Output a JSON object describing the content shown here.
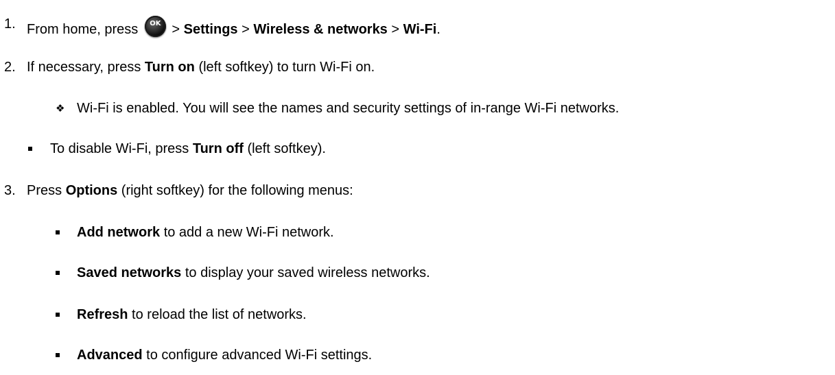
{
  "steps": {
    "step1": {
      "number": "1.",
      "prefix": "From home, press",
      "ok_icon_label": "OK",
      "sep1": ">",
      "settings": "Settings",
      "sep2": ">",
      "wireless": "Wireless & networks",
      "sep3": ">",
      "wifi": "Wi-Fi",
      "end": "."
    },
    "step2": {
      "number": "2.",
      "prefix": "If necessary, press",
      "turn_on": "Turn on",
      "suffix": "(left softkey) to turn Wi-Fi on."
    },
    "result": {
      "bullet": "❖",
      "text": "Wi-Fi is enabled. You will see the names and security settings of in-range Wi-Fi networks."
    },
    "disable": {
      "prefix": "To disable Wi-Fi,  press",
      "turn_off": "Turn off",
      "suffix": "(left softkey)."
    },
    "step3": {
      "number": "3.",
      "prefix": "Press",
      "options": "Options",
      "suffix": "(right softkey) for the following menus:"
    }
  },
  "menu_items": [
    {
      "label": "Add network",
      "desc": "to add a new Wi-Fi network."
    },
    {
      "label": "Saved networks",
      "desc": "to display your saved wireless networks."
    },
    {
      "label": "Refresh",
      "desc": "to reload the list of networks."
    },
    {
      "label": "Advanced",
      "desc": "to configure advanced Wi-Fi settings."
    }
  ],
  "icons": {
    "ok": "ok-button-icon",
    "diamond": "diamond-bullet-icon",
    "square": "square-bullet-icon"
  }
}
